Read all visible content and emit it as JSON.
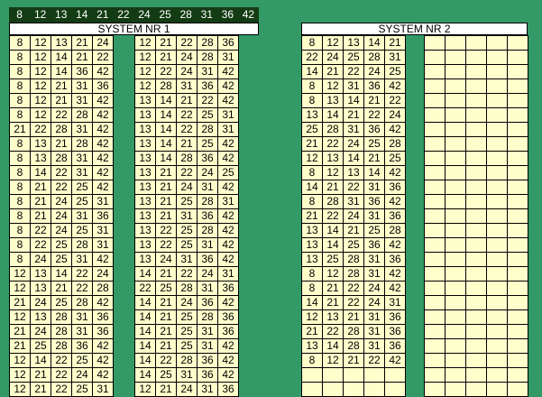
{
  "header": {
    "numbers": [
      "8",
      "12",
      "13",
      "14",
      "21",
      "22",
      "24",
      "25",
      "28",
      "31",
      "36",
      "42"
    ]
  },
  "systems": [
    {
      "title": "SYSTEM NR 1",
      "left_rows": [
        [
          "8",
          "12",
          "13",
          "21",
          "24"
        ],
        [
          "8",
          "12",
          "14",
          "21",
          "22"
        ],
        [
          "8",
          "12",
          "14",
          "36",
          "42"
        ],
        [
          "8",
          "12",
          "21",
          "31",
          "36"
        ],
        [
          "8",
          "12",
          "21",
          "31",
          "42"
        ],
        [
          "8",
          "12",
          "22",
          "28",
          "42"
        ],
        [
          "21",
          "22",
          "28",
          "31",
          "42"
        ],
        [
          "8",
          "13",
          "21",
          "28",
          "42"
        ],
        [
          "8",
          "13",
          "28",
          "31",
          "42"
        ],
        [
          "8",
          "14",
          "22",
          "31",
          "42"
        ],
        [
          "8",
          "21",
          "22",
          "25",
          "42"
        ],
        [
          "8",
          "21",
          "24",
          "25",
          "31"
        ],
        [
          "8",
          "21",
          "24",
          "31",
          "36"
        ],
        [
          "8",
          "22",
          "24",
          "25",
          "31"
        ],
        [
          "8",
          "22",
          "25",
          "28",
          "31"
        ],
        [
          "8",
          "24",
          "25",
          "31",
          "42"
        ],
        [
          "12",
          "13",
          "14",
          "22",
          "24"
        ],
        [
          "12",
          "13",
          "21",
          "22",
          "28"
        ],
        [
          "21",
          "24",
          "25",
          "28",
          "42"
        ],
        [
          "12",
          "13",
          "28",
          "31",
          "36"
        ],
        [
          "21",
          "24",
          "28",
          "31",
          "36"
        ],
        [
          "21",
          "25",
          "28",
          "36",
          "42"
        ],
        [
          "12",
          "14",
          "22",
          "25",
          "42"
        ],
        [
          "12",
          "21",
          "22",
          "24",
          "42"
        ],
        [
          "12",
          "21",
          "22",
          "25",
          "31"
        ]
      ],
      "right_rows": [
        [
          "12",
          "21",
          "22",
          "28",
          "36"
        ],
        [
          "12",
          "21",
          "24",
          "28",
          "31"
        ],
        [
          "12",
          "22",
          "24",
          "31",
          "42"
        ],
        [
          "12",
          "28",
          "31",
          "36",
          "42"
        ],
        [
          "13",
          "14",
          "21",
          "22",
          "42"
        ],
        [
          "13",
          "14",
          "22",
          "25",
          "31"
        ],
        [
          "13",
          "14",
          "22",
          "28",
          "31"
        ],
        [
          "13",
          "14",
          "21",
          "25",
          "42"
        ],
        [
          "13",
          "14",
          "28",
          "36",
          "42"
        ],
        [
          "13",
          "21",
          "22",
          "24",
          "25"
        ],
        [
          "13",
          "21",
          "24",
          "31",
          "42"
        ],
        [
          "13",
          "21",
          "25",
          "28",
          "31"
        ],
        [
          "13",
          "21",
          "31",
          "36",
          "42"
        ],
        [
          "13",
          "22",
          "25",
          "28",
          "42"
        ],
        [
          "13",
          "22",
          "25",
          "31",
          "42"
        ],
        [
          "13",
          "24",
          "31",
          "36",
          "42"
        ],
        [
          "14",
          "21",
          "22",
          "24",
          "31"
        ],
        [
          "22",
          "25",
          "28",
          "31",
          "36"
        ],
        [
          "14",
          "21",
          "24",
          "36",
          "42"
        ],
        [
          "14",
          "21",
          "25",
          "28",
          "36"
        ],
        [
          "14",
          "21",
          "25",
          "31",
          "36"
        ],
        [
          "14",
          "21",
          "25",
          "31",
          "42"
        ],
        [
          "14",
          "22",
          "28",
          "36",
          "42"
        ],
        [
          "14",
          "25",
          "31",
          "36",
          "42"
        ],
        [
          "12",
          "21",
          "24",
          "31",
          "36"
        ]
      ]
    },
    {
      "title": "SYSTEM NR 2",
      "left_rows": [
        [
          "8",
          "12",
          "13",
          "14",
          "21"
        ],
        [
          "22",
          "24",
          "25",
          "28",
          "31"
        ],
        [
          "14",
          "21",
          "22",
          "24",
          "25"
        ],
        [
          "8",
          "12",
          "31",
          "36",
          "42"
        ],
        [
          "8",
          "13",
          "14",
          "21",
          "22"
        ],
        [
          "13",
          "14",
          "21",
          "22",
          "24"
        ],
        [
          "25",
          "28",
          "31",
          "36",
          "42"
        ],
        [
          "21",
          "22",
          "24",
          "25",
          "28"
        ],
        [
          "12",
          "13",
          "14",
          "21",
          "25"
        ],
        [
          "8",
          "12",
          "13",
          "14",
          "42"
        ],
        [
          "14",
          "21",
          "22",
          "31",
          "36"
        ],
        [
          "8",
          "28",
          "31",
          "36",
          "42"
        ],
        [
          "21",
          "22",
          "24",
          "31",
          "36"
        ],
        [
          "13",
          "14",
          "21",
          "25",
          "28"
        ],
        [
          "13",
          "14",
          "25",
          "36",
          "42"
        ],
        [
          "13",
          "25",
          "28",
          "31",
          "36"
        ],
        [
          "8",
          "12",
          "28",
          "31",
          "42"
        ],
        [
          "8",
          "21",
          "22",
          "24",
          "42"
        ],
        [
          "14",
          "21",
          "22",
          "24",
          "31"
        ],
        [
          "12",
          "13",
          "21",
          "31",
          "36"
        ],
        [
          "21",
          "22",
          "28",
          "31",
          "36"
        ],
        [
          "13",
          "14",
          "28",
          "31",
          "36"
        ],
        [
          "8",
          "12",
          "21",
          "22",
          "42"
        ],
        [
          "",
          "",
          "",
          "",
          ""
        ],
        [
          "",
          "",
          "",
          "",
          ""
        ]
      ],
      "right_row_count": 25
    }
  ]
}
